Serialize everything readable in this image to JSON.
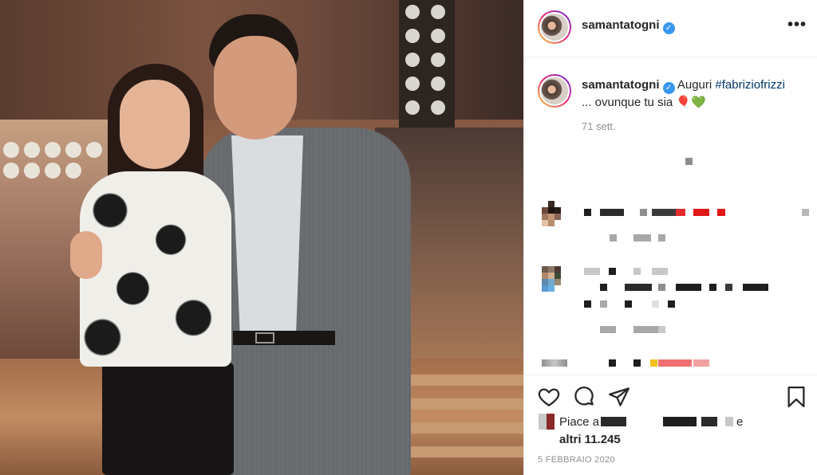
{
  "post": {
    "username": "samantatogni",
    "verified_mark": "✓",
    "more_label": "•••",
    "caption": {
      "username": "samantatogni",
      "text_before": "Auguri ",
      "hashtag": "#fabriziofrizzi",
      "text_after": "... ovunque tu sia",
      "emoji": "🎈💚"
    },
    "time_ago": "71 sett.",
    "likes": {
      "prefix": "Piace a",
      "connector": "e",
      "others": "altri 11.245"
    },
    "date": "5 FEBBRAIO 2020"
  },
  "icons": {
    "like": "heart-icon",
    "comment": "comment-icon",
    "share": "share-icon",
    "save": "bookmark-icon",
    "more": "more-icon"
  },
  "colors": {
    "text": "#262626",
    "secondary": "#8e8e8e",
    "hashtag": "#00376b",
    "verified": "#3897f0",
    "border": "#efefef"
  }
}
